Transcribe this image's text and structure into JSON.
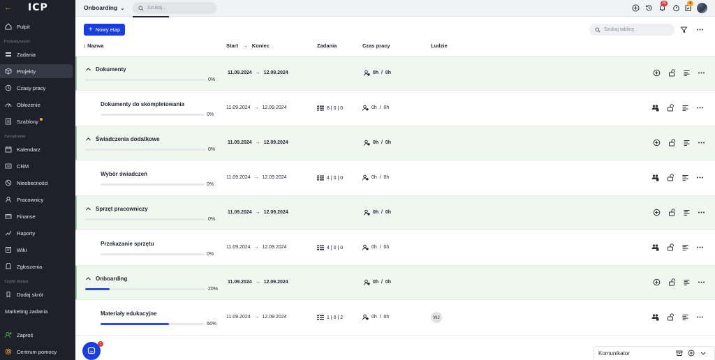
{
  "sidebar": {
    "logo": "ICP",
    "sections": {
      "productivity": "Produktywność",
      "management": "Zarządzanie",
      "quick_access": "Szybki dostęp"
    },
    "items": [
      {
        "label": "Pulpit",
        "icon": "home-icon"
      },
      {
        "label": "Zadania",
        "icon": "tasks-icon"
      },
      {
        "label": "Projekty",
        "icon": "cube-icon"
      },
      {
        "label": "Czasy pracy",
        "icon": "timer-icon"
      },
      {
        "label": "Obłożenie",
        "icon": "load-icon"
      },
      {
        "label": "Szablony",
        "icon": "template-icon"
      },
      {
        "label": "Kalendarz",
        "icon": "calendar-icon"
      },
      {
        "label": "CRM",
        "icon": "crm-icon"
      },
      {
        "label": "Nieobecności",
        "icon": "absence-icon"
      },
      {
        "label": "Pracownicy",
        "icon": "users-icon"
      },
      {
        "label": "Finanse",
        "icon": "finance-icon"
      },
      {
        "label": "Raporty",
        "icon": "report-icon"
      },
      {
        "label": "Wiki",
        "icon": "wiki-icon"
      },
      {
        "label": "Zgłoszenia",
        "icon": "ticket-icon"
      },
      {
        "label": "Dodaj skrót",
        "icon": "add-shortcut-icon"
      },
      {
        "label": "Marketing zadania",
        "icon": ""
      },
      {
        "label": "Zaproś",
        "icon": "invite-icon"
      },
      {
        "label": "Centrum pomocy",
        "icon": "help-icon"
      }
    ]
  },
  "topbar": {
    "project_selector": "Onboarding",
    "search_placeholder": "Szukaj...",
    "notifications_badge": "26",
    "tasks_badge": "4"
  },
  "toolbar": {
    "new_stage_label": "Nowy etap",
    "board_search_placeholder": "Szukaj tablicę"
  },
  "table": {
    "headers": {
      "name": "Nazwa",
      "start": "Start",
      "end": "Koniec",
      "tasks": "Zadania",
      "worktime": "Czas pracy",
      "people": "Ludzie"
    },
    "rows": [
      {
        "kind": "group",
        "name": "Dokumenty",
        "progress": 0,
        "pct": "0%",
        "start": "11.09.2024",
        "end": "12.09.2024",
        "time": "0h",
        "time_total": "0h"
      },
      {
        "kind": "task",
        "name": "Dokumenty do skompletowania",
        "progress": 0,
        "pct": "0%",
        "start": "11.09.2024",
        "end": "12.09.2024",
        "tasks_a": "8",
        "tasks_b": "0",
        "tasks_c": "0",
        "time": "0h",
        "time_total": "0h"
      },
      {
        "kind": "group",
        "name": "Świadczenia dodatkowe",
        "progress": 0,
        "pct": "0%",
        "start": "11.09.2024",
        "end": "12.09.2024",
        "time": "0h",
        "time_total": "0h"
      },
      {
        "kind": "task",
        "name": "Wybór świadczeń",
        "progress": 0,
        "pct": "0%",
        "start": "11.09.2024",
        "end": "12.09.2024",
        "tasks_a": "4",
        "tasks_b": "0",
        "tasks_c": "0",
        "time": "0h",
        "time_total": "0h"
      },
      {
        "kind": "group",
        "name": "Sprzęt pracowniczy",
        "progress": 0,
        "pct": "0%",
        "start": "11.09.2024",
        "end": "12.09.2024",
        "time": "0h",
        "time_total": "0h"
      },
      {
        "kind": "task",
        "name": "Przekazanie sprzętu",
        "progress": 0,
        "pct": "0%",
        "start": "11.09.2024",
        "end": "12.09.2024",
        "tasks_a": "4",
        "tasks_b": "0",
        "tasks_c": "0",
        "time": "0h",
        "time_total": "0h"
      },
      {
        "kind": "group",
        "name": "Onboarding",
        "progress": 0.2,
        "pct": "20%",
        "start": "11.09.2024",
        "end": "12.09.2024",
        "time": "0h",
        "time_total": "0h"
      },
      {
        "kind": "task",
        "name": "Materiały edukacyjne",
        "progress": 0.66,
        "pct": "66%",
        "start": "11.09.2024",
        "end": "12.09.2024",
        "tasks_a": "1",
        "tasks_b": "0",
        "tasks_c": "2",
        "time": "0h",
        "time_total": "0h",
        "people": "WJ"
      }
    ]
  },
  "communicator": {
    "label": "Komunikator"
  },
  "chat": {
    "badge": "1"
  },
  "colors": {
    "accent": "#1a3fe0",
    "group_bg": "#eef8ee",
    "sidebar_bg": "#1e2129"
  }
}
